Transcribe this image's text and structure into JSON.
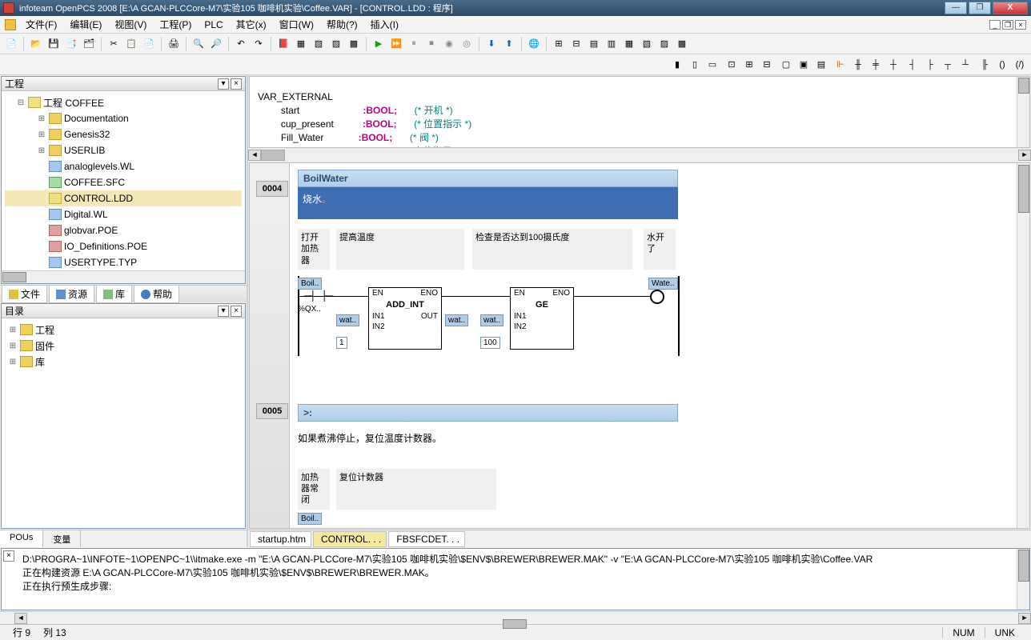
{
  "title": "infoteam OpenPCS 2008 [E:\\A  GCAN-PLCCore-M7\\实验105 咖啡机实验\\Coffee.VAR]  - [CONTROL.LDD : 程序]",
  "menu": [
    "文件(F)",
    "编辑(E)",
    "视图(V)",
    "工程(P)",
    "PLC",
    "其它(x)",
    "窗口(W)",
    "帮助(?)",
    "插入(I)"
  ],
  "panels": {
    "project": "工程",
    "catalog": "目录"
  },
  "tree": {
    "root": "工程 COFFEE",
    "items": [
      {
        "label": "Documentation",
        "icon": "folder",
        "exp": "+"
      },
      {
        "label": "Genesis32",
        "icon": "folder",
        "exp": "+"
      },
      {
        "label": "USERLIB",
        "icon": "folder",
        "exp": "+"
      },
      {
        "label": "analoglevels.WL",
        "icon": "fileblue"
      },
      {
        "label": "COFFEE.SFC",
        "icon": "filegreen"
      },
      {
        "label": "CONTROL.LDD",
        "icon": "fileyellow",
        "sel": true
      },
      {
        "label": "Digital.WL",
        "icon": "fileblue"
      },
      {
        "label": "globvar.POE",
        "icon": "filered"
      },
      {
        "label": "IO_Definitions.POE",
        "icon": "filered"
      },
      {
        "label": "USERTYPE.TYP",
        "icon": "fileblue"
      }
    ]
  },
  "sidetabs": [
    {
      "label": "文件",
      "icon": "y"
    },
    {
      "label": "资源",
      "icon": "b"
    },
    {
      "label": "库",
      "icon": "g"
    },
    {
      "label": "帮助",
      "icon": "q"
    }
  ],
  "catalog": [
    {
      "label": "工程",
      "exp": "+"
    },
    {
      "label": "固件",
      "exp": "+"
    },
    {
      "label": "库",
      "exp": "+"
    }
  ],
  "bottomtabs": [
    "POUs",
    "变量"
  ],
  "code": {
    "l1": "VAR_EXTERNAL",
    "rows": [
      {
        "name": "start",
        "type": ":BOOL;",
        "cmt": "(* 开机 *)"
      },
      {
        "name": "cup_present",
        "type": ":BOOL;",
        "cmt": "(* 位置指示 *)"
      },
      {
        "name": "Fill_Water",
        "type": ":BOOL;",
        "cmt": "(* 阀 *)"
      },
      {
        "name": "water_Full",
        "type": ":bool;",
        "cmt": "(* 水位指示 *)"
      }
    ]
  },
  "diagram": {
    "step4num": "0004",
    "step4title": "BoilWater",
    "step4body": "烧水",
    "c1": "打开加热器",
    "c2": "提高温度",
    "c3": "检查是否达到100摄氏度",
    "c4": "水开了",
    "boil": "Boil..",
    "qx": "%QX..",
    "wat": "wat..",
    "one": "1",
    "hundred": "100",
    "fb1": "ADD_INT",
    "fb2": "GE",
    "en": "EN",
    "eno": "ENO",
    "in1": "IN1",
    "in2": "IN2",
    "out": "OUT",
    "wate": "Wate..",
    "step5num": "0005",
    "step5arrow": ">:",
    "step5text": "如果煮沸停止，复位温度计数器。",
    "c5": "加热器常闭",
    "c6": "复位计数器"
  },
  "doctabs": [
    {
      "label": "startup.htm",
      "icon": "b"
    },
    {
      "label": "CONTROL. . .",
      "icon": "y",
      "active": true
    },
    {
      "label": "FBSFCDET. . .",
      "icon": "y"
    }
  ],
  "output": {
    "l1": "D:\\PROGRA~1\\INFOTE~1\\OPENPC~1\\\\itmake.exe -m \"E:\\A  GCAN-PLCCore-M7\\实验105 咖啡机实验\\$ENV$\\BREWER\\BREWER.MAK\" -v \"E:\\A  GCAN-PLCCore-M7\\实验105 咖啡机实验\\Coffee.VAR",
    "l2": "正在构建资源 E:\\A  GCAN-PLCCore-M7\\实验105 咖啡机实验\\$ENV$\\BREWER\\BREWER.MAK。",
    "l3": "正在执行预生成步骤:"
  },
  "status": {
    "row": "行 9",
    "col": "列 13",
    "num": "NUM",
    "unk": "UNK"
  }
}
